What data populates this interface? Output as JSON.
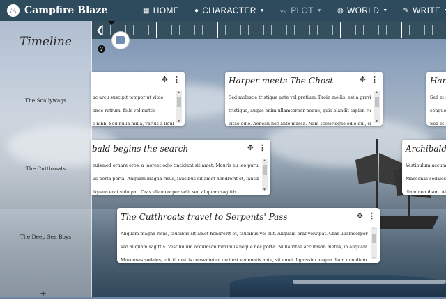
{
  "nav": {
    "brand": "Campfire Blaze",
    "items": [
      {
        "label": "HOME",
        "icon": "home-icon",
        "caret": false,
        "active": false
      },
      {
        "label": "CHARACTER",
        "icon": "person-icon",
        "caret": true,
        "active": false
      },
      {
        "label": "PLOT",
        "icon": "chart-line-icon",
        "caret": true,
        "active": true
      },
      {
        "label": "WORLD",
        "icon": "globe-icon",
        "caret": true,
        "active": false
      },
      {
        "label": "WRITE",
        "icon": "pencil-icon",
        "caret": true,
        "active": false
      }
    ]
  },
  "sidebar": {
    "title": "Timeline",
    "tracks": [
      "The Scallywags",
      "The Cutthroats",
      "The Deep Sea Boys"
    ],
    "add_label": "+"
  },
  "help_label": "?",
  "cards": [
    {
      "title": "",
      "lines": [
        "ac arcu suscipit tempor ut vitae",
        "onec rutrum, felis vel mattis",
        "s nibh. Sed nulla nulla, varius a lieula"
      ]
    },
    {
      "title": "Harper meets The Ghost",
      "lines": [
        "Sed molestie tristique ante vel pretium. Proin mollis, est a gravida",
        "tristique, augue enim ullamcorper neque, quis blandit sapien risus",
        "vitae odio. Aenean nec ante massa. Nam scelerisque odio dui, sit"
      ]
    },
    {
      "title": "Harp",
      "lines": [
        "Sed et c",
        "congue",
        "Sed et c"
      ]
    },
    {
      "title": "bald begins the search",
      "lines": [
        "euismod ornare eros, a laoreet odio tincidunt sit amet. Mauris eu leo purus.",
        "us porta porta. Aliquam magna risus, faucibus sit amet hendrerit et, faucibus",
        "liquam erat volutpat. Cras ullamcorper velit sed aliquam sagittis."
      ]
    },
    {
      "title": "Archibald",
      "lines": [
        "Vestibulum accumsan",
        "Maecenas sodales,",
        "diam non diam. Ali"
      ]
    },
    {
      "title": "The Cutthroats travel to Serpents' Pass",
      "lines": [
        "Aliquam magna risus, faucibus sit amet hendrerit et, faucibus vel elit. Aliquam erat volutpat. Cras ullamcorper velit",
        "sed aliquam sagittis. Vestibulum accumsan maximus neque nec porta. Nulla vitae accumsan metus, in aliquam mi.",
        "Maecenas sodales, elit id mattis consectetur, orci est venenatis ante, sit amet dignissim magna diam non diam."
      ]
    }
  ]
}
